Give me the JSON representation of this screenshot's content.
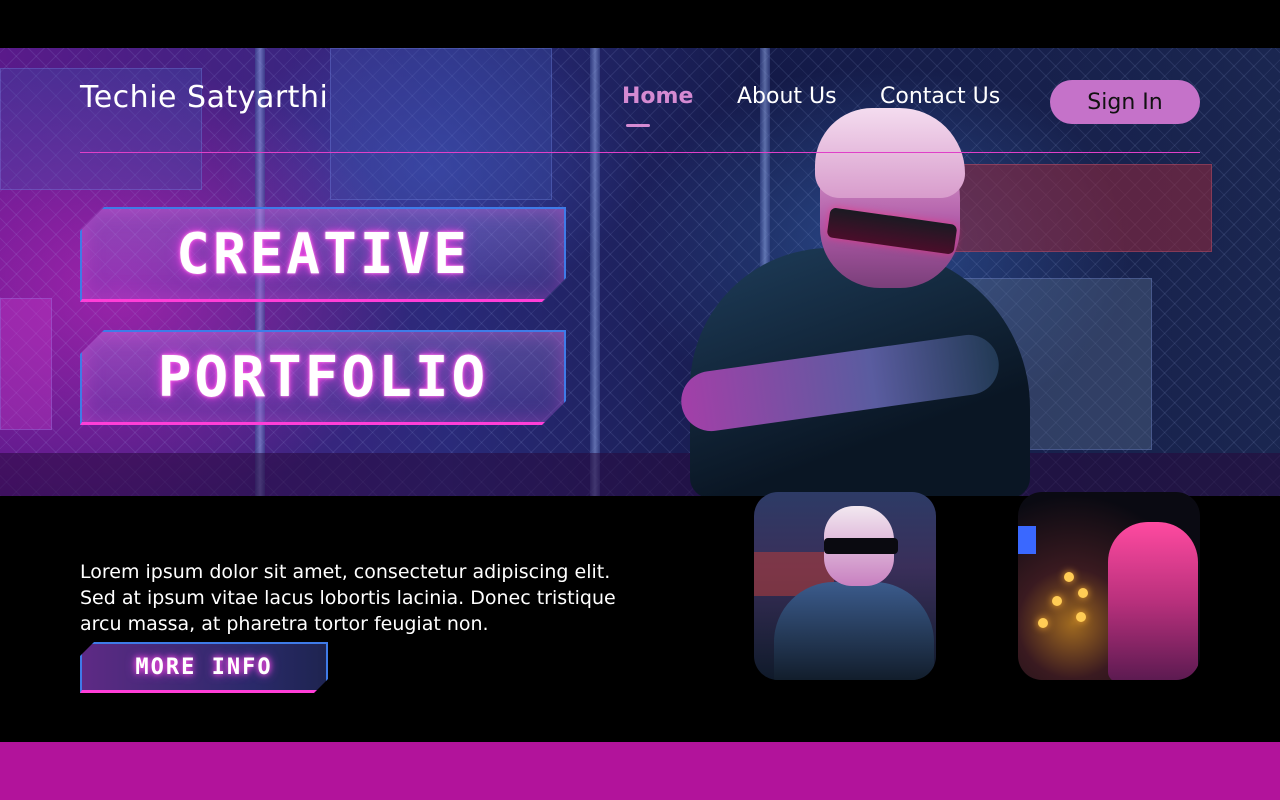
{
  "header": {
    "brand": "Techie Satyarthi",
    "nav": [
      {
        "label": "Home",
        "active": true
      },
      {
        "label": "About Us",
        "active": false
      },
      {
        "label": "Contact Us",
        "active": false
      }
    ],
    "sign_in_label": "Sign In"
  },
  "hero": {
    "title_line1": "CREATIVE",
    "title_line2": "PORTFOLIO"
  },
  "intro": {
    "description": "Lorem ipsum dolor sit amet, consectetur adipiscing elit. Sed at ipsum vitae lacus lobortis lacinia. Donec tristique arcu massa, at pharetra tortor feugiat non.",
    "more_info_label": "MORE INFO"
  },
  "colors": {
    "accent": "#d58ad2",
    "button": "#c572c9",
    "divider": "#e040c8",
    "footer": "#b2139b",
    "neon_blue": "#3f7be8",
    "neon_pink": "#ff3ed8"
  }
}
